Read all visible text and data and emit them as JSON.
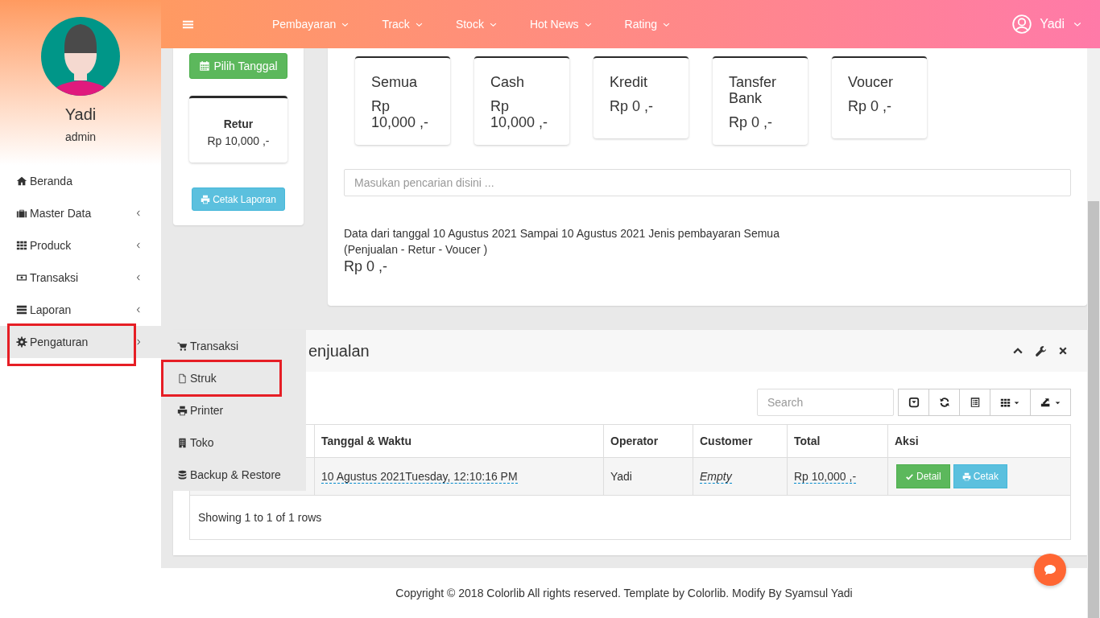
{
  "sidebar": {
    "user": {
      "name": "Yadi",
      "role": "admin"
    },
    "items": [
      {
        "label": "Beranda",
        "kind": "link",
        "highlighted": false
      },
      {
        "label": "Master Data",
        "kind": "group",
        "expanded": false,
        "highlighted": false
      },
      {
        "label": "Produck",
        "kind": "group",
        "expanded": false,
        "highlighted": false
      },
      {
        "label": "Transaksi",
        "kind": "group",
        "expanded": false,
        "highlighted": false
      },
      {
        "label": "Laporan",
        "kind": "group",
        "expanded": false,
        "highlighted": false
      },
      {
        "label": "Pengaturan",
        "kind": "group",
        "expanded": true,
        "highlighted": true,
        "submenu": [
          {
            "label": "Transaksi",
            "highlighted": false
          },
          {
            "label": "Struk",
            "highlighted": true
          },
          {
            "label": "Printer",
            "highlighted": false
          },
          {
            "label": "Toko",
            "highlighted": false
          },
          {
            "label": "Backup & Restore",
            "highlighted": false
          }
        ]
      }
    ]
  },
  "navbar": {
    "menu": [
      "Pembayaran",
      "Track",
      "Stock",
      "Hot News",
      "Rating"
    ],
    "user": "Yadi"
  },
  "filter_card": {
    "date_button": "Pilih Tanggal",
    "retur": {
      "label": "Retur",
      "value": "Rp 10,000 ,-"
    },
    "print_button": "Cetak Laporan"
  },
  "summary_card": {
    "stats": [
      {
        "label": "Semua",
        "value": "Rp 10,000 ,-"
      },
      {
        "label": "Cash",
        "value": "Rp 10,000 ,-"
      },
      {
        "label": "Kredit",
        "value": "Rp 0 ,-"
      },
      {
        "label": "Tansfer Bank",
        "value": "Rp 0 ,-"
      },
      {
        "label": "Voucer",
        "value": "Rp 0 ,-"
      }
    ],
    "search": {
      "placeholder": "Masukan pencarian disini ..."
    },
    "range_text": "Data dari tanggal 10 Agustus 2021 Sampai 10 Agustus 2021 Jenis pembayaran Semua",
    "formula_text": "(Penjualan - Retur - Voucer )",
    "total": "Rp 0 ,-"
  },
  "sales_panel": {
    "title": "enjualan",
    "search": {
      "placeholder": "Search"
    },
    "table": {
      "columns": [
        "Tanggal & Waktu",
        "Operator",
        "Customer",
        "Total",
        "Aksi"
      ],
      "rows": [
        {
          "date_time": "10 Agustus 2021Tuesday, 12:10:16 PM",
          "operator": "Yadi",
          "customer": "Empty",
          "total": "Rp 10,000 ,-",
          "actions": [
            "Detail",
            "Cetak"
          ]
        }
      ],
      "footer": "Showing 1 to 1 of 1 rows"
    }
  },
  "footer": "Copyright © 2018 Colorlib All rights reserved. Template by Colorlib. Modify By Syamsul Yadi"
}
